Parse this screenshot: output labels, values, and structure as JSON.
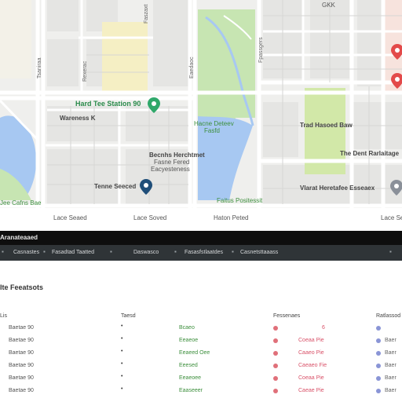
{
  "map": {
    "labels": {
      "heading": "Hard Tee Station 90",
      "left_mid": "Wareness K",
      "park_mid": "Hacne Deteev",
      "park_mid_sub": "Fasfd",
      "right_mid": "Trad Hasoed Baw",
      "right_dock": "The Dent Rarlaitage",
      "center_block": "Becnhs Herchtmet",
      "center_block_2": "Fasne Fered",
      "center_block_3": "Eacyesteness",
      "pin_label": "Tenne Seeced",
      "bottom_left": "Jee Cafns Bae",
      "park_bottom": "Faitus Positessit",
      "right_bottom": "Vlarat Heretafee Esseaex",
      "vert_a": "Rexerac",
      "vert_b": "Tsaniraa",
      "vert_c": "Eaedaoc",
      "vert_d": "Fpassgers",
      "vert_e": "Faszaxt",
      "top_right": "GKK"
    },
    "below": [
      "Lace Seaed",
      "Lace Soved",
      "Haton Peted",
      "Lace Seaed"
    ]
  },
  "title_bar": {
    "text": "Aranateaaed"
  },
  "tabs": [
    "Casnastes",
    "Fasadtad Taatted",
    "Daswasco",
    "Fasasfstlaatdes",
    "Casnetsttaaass"
  ],
  "panel": {
    "title": "Ite Feeatsots",
    "columns": [
      "Lis",
      "Taesd",
      "Fessenaes",
      "Ratlassod"
    ],
    "rows": [
      {
        "name": "Baetae  90",
        "dot": "•",
        "status": "Bcaeo",
        "red": "6",
        "tail": ""
      },
      {
        "name": "Baetae  90",
        "dot": "•",
        "status": "Eeaeoe",
        "red": "Coeaa  Pie",
        "tail": "Baer"
      },
      {
        "name": "Baetae  90",
        "dot": "•",
        "status": "Eeaeed  Oee",
        "red": "Caaeo  Pie",
        "tail": "Baer"
      },
      {
        "name": "Baetae  90",
        "dot": "•",
        "status": "Eeesed",
        "red": "Caeaeo  Fie",
        "tail": "Baer"
      },
      {
        "name": "Baetae  90",
        "dot": "•",
        "status": "Eeaeoee",
        "red": "Coeaa  Pie",
        "tail": "Baer"
      },
      {
        "name": "Baetae  90",
        "dot": "•",
        "status": "Eaaseeer",
        "red": "Caeae  Pie",
        "tail": "Baer"
      }
    ]
  },
  "colors": {
    "park": "#c7e5b2",
    "water": "#a7c8f2",
    "road": "#ffffff",
    "block": "#e7e7e5",
    "yellow_area": "#f5efc4",
    "dark_bar": "#0e0e0e",
    "tab_bar": "#2f3437",
    "green_text": "#3d8f3d",
    "red_text": "#d9536a"
  }
}
